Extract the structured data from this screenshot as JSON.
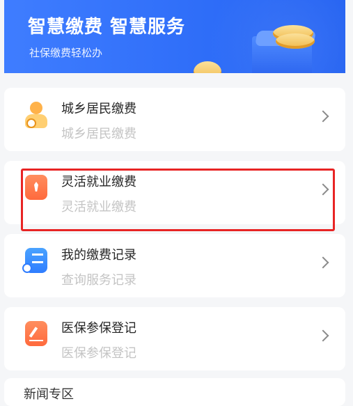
{
  "banner": {
    "title": "智慧缴费  智慧服务",
    "subtitle": "社保缴费轻松办"
  },
  "menu": [
    {
      "title": "城乡居民缴费",
      "subtitle": "城乡居民缴费",
      "icon": "person-badge-icon"
    },
    {
      "title": "灵活就业缴费",
      "subtitle": "灵活就业缴费",
      "icon": "tie-icon"
    },
    {
      "title": "我的缴费记录",
      "subtitle": "查询服务记录",
      "icon": "record-search-icon"
    },
    {
      "title": "医保参保登记",
      "subtitle": "医保参保登记",
      "icon": "edit-icon"
    }
  ],
  "news": {
    "title": "新闻专区"
  },
  "colors": {
    "banner": "#2e6df8",
    "highlight": "#e82424",
    "icon_orange": "#ff6a3d",
    "icon_blue": "#2f7dff"
  }
}
